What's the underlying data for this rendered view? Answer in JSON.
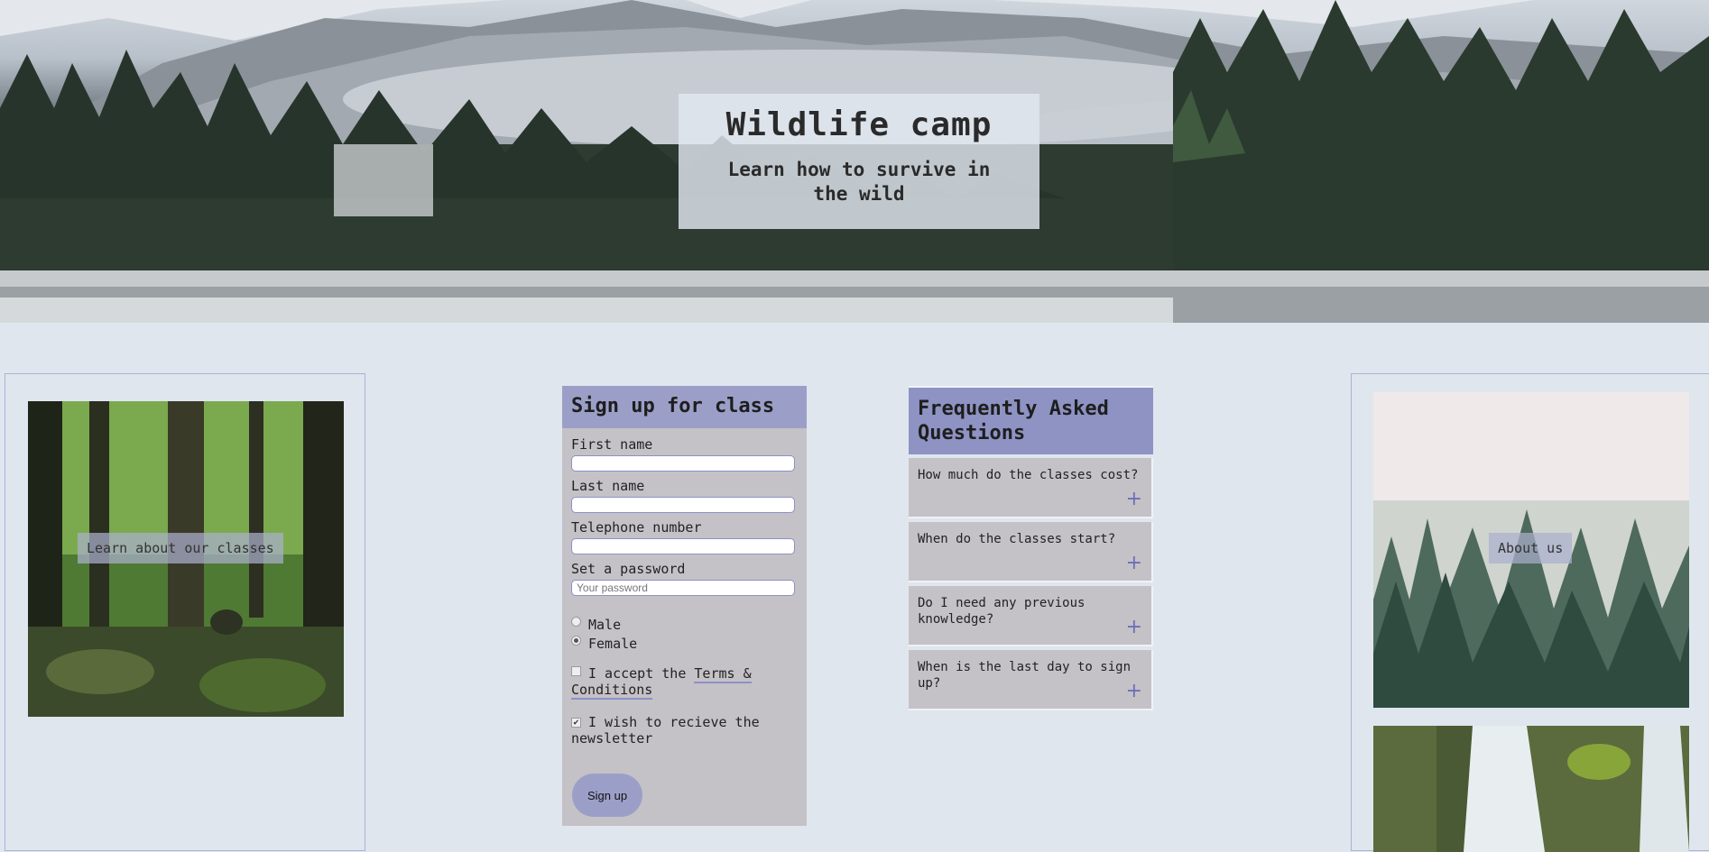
{
  "hero": {
    "title": "Wildlife camp",
    "subtitle": "Learn how to survive in the wild"
  },
  "left_panel": {
    "image_label": "Learn about our classes"
  },
  "signup": {
    "heading": "Sign up for class",
    "first_name_label": "First name",
    "last_name_label": "Last name",
    "telephone_label": "Telephone number",
    "password_label": "Set a password",
    "password_placeholder": "Your password",
    "gender_options": [
      "Male",
      "Female"
    ],
    "selected_gender": "Female",
    "terms_prefix": "I accept the ",
    "terms_link": "Terms & Conditions",
    "terms_checked": false,
    "newsletter_label": "I wish to recieve the newsletter",
    "newsletter_checked": true,
    "submit_label": "Sign up"
  },
  "faq": {
    "heading": "Frequently Asked Questions",
    "items": [
      {
        "question": "How much do the classes cost?",
        "icon": "plus-icon"
      },
      {
        "question": "When do the classes start?",
        "icon": "plus-icon"
      },
      {
        "question": "Do I need any previous knowledge?",
        "icon": "plus-icon"
      },
      {
        "question": "When is the last day to sign up?",
        "icon": "plus-icon"
      }
    ]
  },
  "right_panel": {
    "image_label": "About us"
  },
  "colors": {
    "background": "#dfe6ee",
    "accent": "#9b9fc8",
    "card": "#c4c2c7"
  }
}
